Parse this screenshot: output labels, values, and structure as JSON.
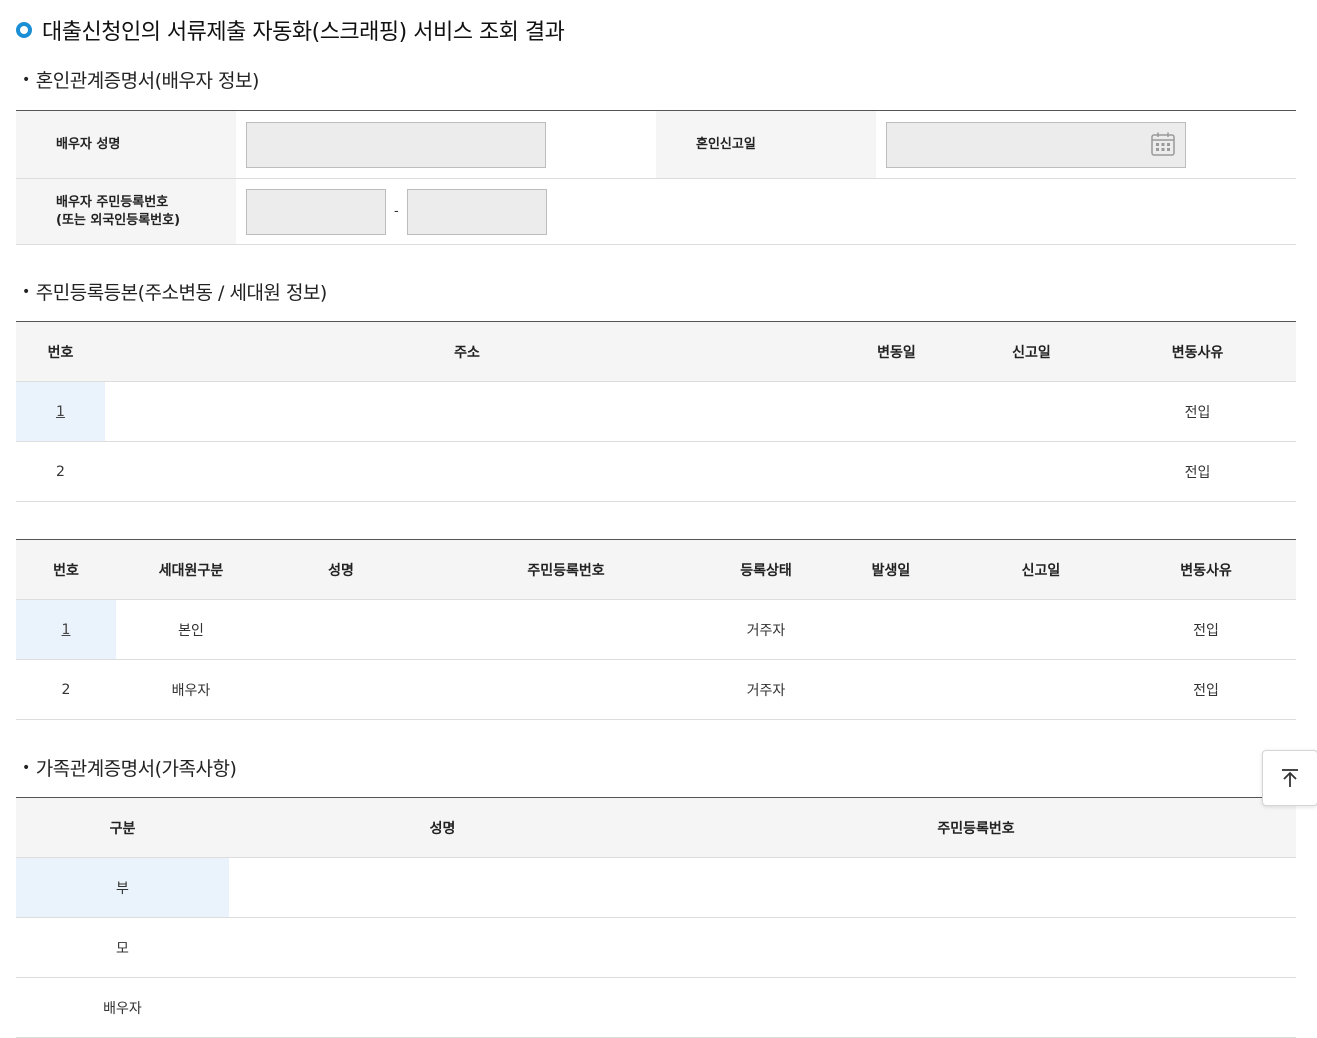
{
  "page": {
    "title": "대출신청인의 서류제출 자동화(스크래핑) 서비스 조회 결과"
  },
  "marriage": {
    "section_title": "혼인관계증명서(배우자 정보)",
    "spouse_name_label": "배우자 성명",
    "marriage_date_label": "혼인신고일",
    "rrn_label_line1": "배우자 주민등록번호",
    "rrn_label_line2": "(또는 외국인등록번호)",
    "rrn_separator": "-",
    "spouse_name_value": "",
    "marriage_date_value": "",
    "rrn_front_value": "",
    "rrn_back_value": ""
  },
  "resident": {
    "section_title": "주민등록등본(주소변동 / 세대원 정보)",
    "address_table": {
      "headers": [
        "번호",
        "주소",
        "변동일",
        "신고일",
        "변동사유"
      ],
      "rows": [
        {
          "no": "1",
          "address": "",
          "change_date": "",
          "report_date": "",
          "reason": "전입"
        },
        {
          "no": "2",
          "address": "",
          "change_date": "",
          "report_date": "",
          "reason": "전입"
        }
      ]
    },
    "member_table": {
      "headers": [
        "번호",
        "세대원구분",
        "성명",
        "주민등록번호",
        "등록상태",
        "발생일",
        "신고일",
        "변동사유"
      ],
      "rows": [
        {
          "no": "1",
          "type": "본인",
          "name": "",
          "rrn": "",
          "status": "거주자",
          "occur_date": "",
          "report_date": "",
          "reason": "전입"
        },
        {
          "no": "2",
          "type": "배우자",
          "name": "",
          "rrn": "",
          "status": "거주자",
          "occur_date": "",
          "report_date": "",
          "reason": "전입"
        }
      ]
    }
  },
  "family": {
    "section_title": "가족관계증명서(가족사항)",
    "headers": [
      "구분",
      "성명",
      "주민등록번호"
    ],
    "rows": [
      {
        "type": "부",
        "name": "",
        "rrn": ""
      },
      {
        "type": "모",
        "name": "",
        "rrn": ""
      },
      {
        "type": "배우자",
        "name": "",
        "rrn": ""
      }
    ]
  },
  "icons": {
    "title_marker": "ring-icon",
    "calendar": "calendar-icon",
    "scroll_top": "arrow-up-to-top-icon"
  },
  "colors": {
    "accent": "#1a8fd6",
    "highlight_row": "#eaf3fb",
    "header_bg": "#f5f5f5"
  }
}
